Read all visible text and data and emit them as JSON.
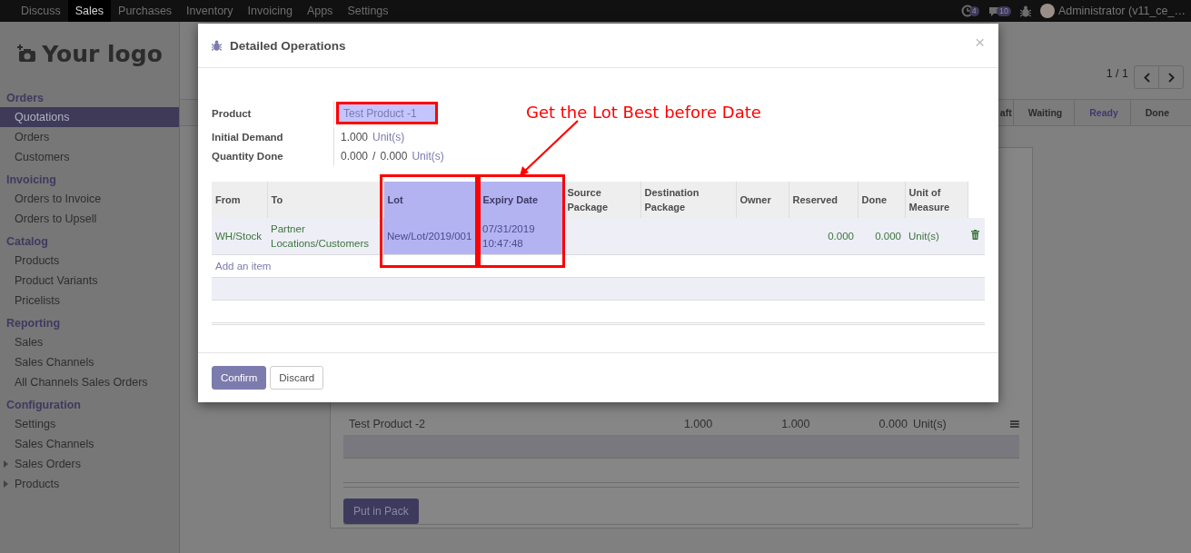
{
  "navbar": {
    "menu": [
      {
        "label": "Discuss",
        "selected": false
      },
      {
        "label": "Sales",
        "selected": true
      },
      {
        "label": "Purchases",
        "selected": false
      },
      {
        "label": "Inventory",
        "selected": false
      },
      {
        "label": "Invoicing",
        "selected": false
      },
      {
        "label": "Apps",
        "selected": false
      },
      {
        "label": "Settings",
        "selected": false
      }
    ],
    "activity_badge": "4",
    "messages_badge": "10",
    "user": "Administrator (v11_ce_…"
  },
  "sidebar": {
    "logo": "Your logo",
    "sections": [
      {
        "title": "Orders",
        "items": [
          {
            "label": "Quotations",
            "kind": "link",
            "selected": true
          },
          {
            "label": "Orders",
            "kind": "link",
            "selected": false
          },
          {
            "label": "Customers",
            "kind": "link",
            "selected": false
          }
        ]
      },
      {
        "title": "Invoicing",
        "items": [
          {
            "label": "Orders to Invoice",
            "kind": "link",
            "selected": false
          },
          {
            "label": "Orders to Upsell",
            "kind": "link",
            "selected": false
          }
        ]
      },
      {
        "title": "Catalog",
        "items": [
          {
            "label": "Products",
            "kind": "link",
            "selected": false
          },
          {
            "label": "Product Variants",
            "kind": "link",
            "selected": false
          },
          {
            "label": "Pricelists",
            "kind": "link",
            "selected": false
          }
        ]
      },
      {
        "title": "Reporting",
        "items": [
          {
            "label": "Sales",
            "kind": "link",
            "selected": false
          },
          {
            "label": "Sales Channels",
            "kind": "link",
            "selected": false
          },
          {
            "label": "All Channels Sales Orders",
            "kind": "link",
            "selected": false
          }
        ]
      },
      {
        "title": "Configuration",
        "items": [
          {
            "label": "Settings",
            "kind": "link",
            "selected": false
          },
          {
            "label": "Sales Channels",
            "kind": "link",
            "selected": false
          },
          {
            "label": "Sales Orders",
            "kind": "folder",
            "expanded": false,
            "selected": false
          },
          {
            "label": "Products",
            "kind": "folder",
            "expanded": false,
            "selected": false
          }
        ]
      }
    ]
  },
  "form": {
    "pager": "1 / 1",
    "stages": [
      {
        "label": "aft",
        "selected": false
      },
      {
        "label": "Waiting",
        "selected": false
      },
      {
        "label": "Ready",
        "selected": true
      },
      {
        "label": "Done",
        "selected": false
      }
    ],
    "rows": [
      {
        "product": "Test Product -2",
        "cells": [
          "1.000",
          "1.000",
          "0.000",
          "Unit(s)"
        ]
      }
    ],
    "put_in_pack": "Put in Pack"
  },
  "dialog": {
    "title": "Detailed Operations",
    "close": "×",
    "fields": [
      {
        "label": "Product",
        "highlighted": true,
        "values": [
          {
            "text": "Test Product -1",
            "kind": "link"
          }
        ]
      },
      {
        "label": "Initial Demand",
        "highlighted": false,
        "values": [
          {
            "text": "1.000",
            "kind": "number"
          },
          {
            "text": "Unit(s)",
            "kind": "link"
          }
        ]
      },
      {
        "label": "Quantity Done",
        "highlighted": false,
        "values": [
          {
            "text": "0.000",
            "kind": "number"
          },
          {
            "text": "/",
            "kind": "number"
          },
          {
            "text": "0.000",
            "kind": "number"
          },
          {
            "text": "Unit(s)",
            "kind": "link"
          }
        ]
      }
    ],
    "columns": [
      {
        "label": "From",
        "highlighted": false
      },
      {
        "label": "To",
        "highlighted": false
      },
      {
        "label": "Lot",
        "highlighted": true
      },
      {
        "label": "Expiry Date",
        "highlighted": true
      },
      {
        "label": "Source Package",
        "highlighted": false
      },
      {
        "label": "Destination Package",
        "highlighted": false
      },
      {
        "label": "Owner",
        "highlighted": false
      },
      {
        "label": "Reserved",
        "highlighted": false
      },
      {
        "label": "Done",
        "highlighted": false
      },
      {
        "label": "Unit of Measure",
        "highlighted": false
      }
    ],
    "rows": [
      {
        "from": "WH/Stock",
        "to": "Partner Locations/Customers",
        "lot": "New/Lot/2019/001",
        "expiry_date": "07/31/2019 10:47:48",
        "reserved": "0.000",
        "done": "0.000",
        "unit_of_measure": "Unit(s)"
      }
    ],
    "add_item": "Add an item",
    "buttons": [
      {
        "label": "Confirm",
        "kind": "primary"
      },
      {
        "label": "Discard",
        "kind": "secondary"
      }
    ]
  },
  "annotation": {
    "text": "Get the Lot Best before Date"
  }
}
